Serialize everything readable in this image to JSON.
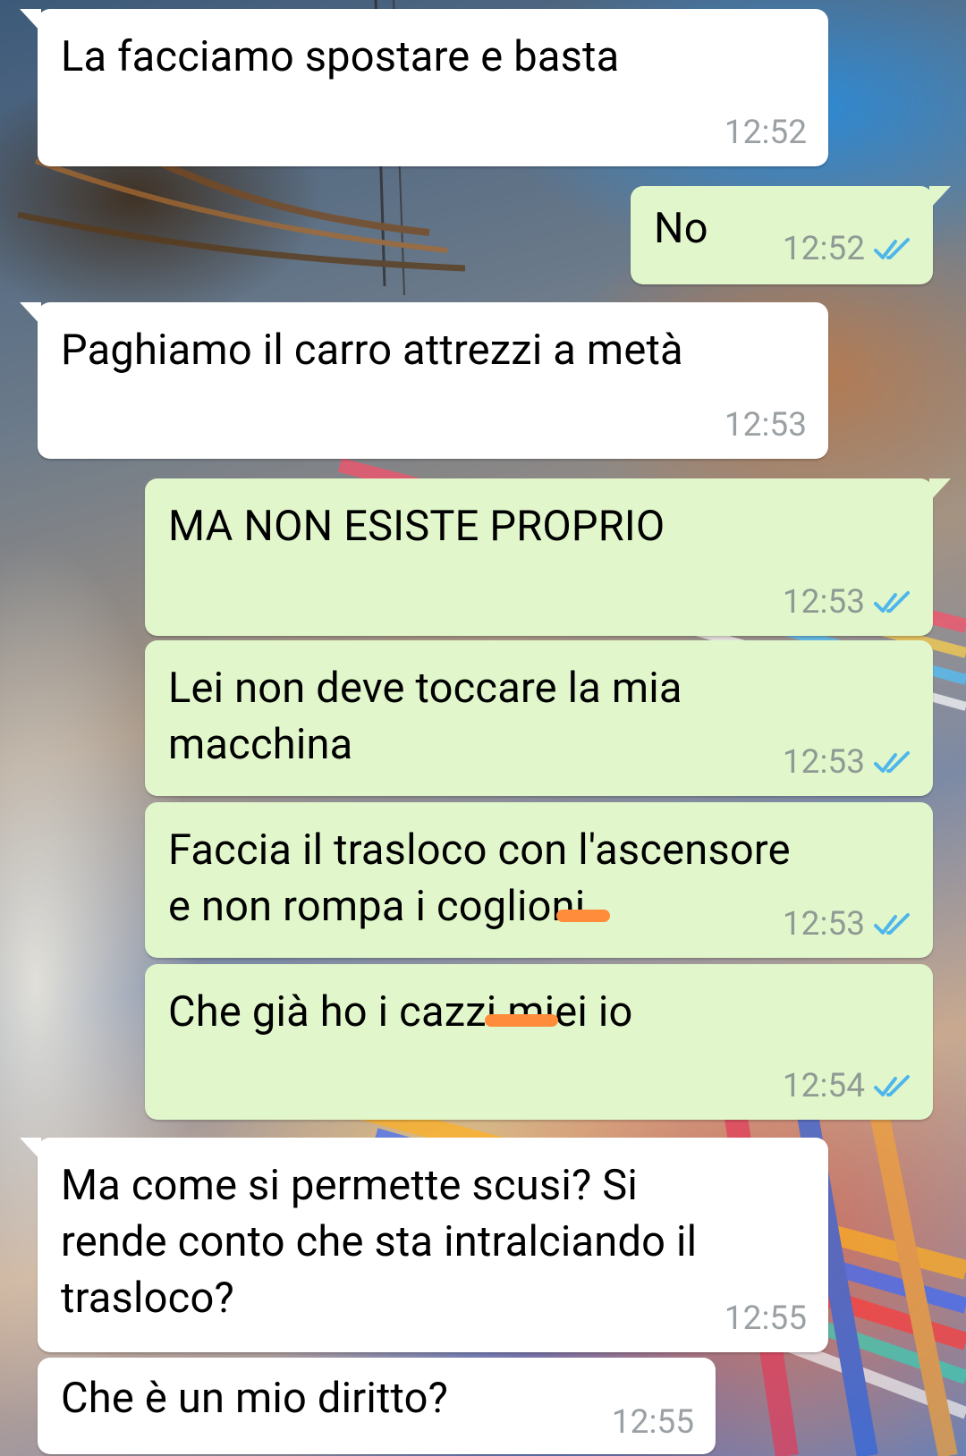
{
  "messages": [
    {
      "id": "m1",
      "direction": "incoming",
      "text": "La facciamo spostare e basta",
      "time": "12:52"
    },
    {
      "id": "m2",
      "direction": "outgoing",
      "text": "No",
      "time": "12:52",
      "status": "read"
    },
    {
      "id": "m3",
      "direction": "incoming",
      "text": "Paghiamo il carro attrezzi a metà",
      "time": "12:53"
    },
    {
      "id": "m4",
      "direction": "outgoing",
      "text": "MA NON ESISTE PROPRIO",
      "time": "12:53",
      "status": "read"
    },
    {
      "id": "m5",
      "direction": "outgoing",
      "text": "Lei non deve toccare la mia\nmacchina",
      "time": "12:53",
      "status": "read"
    },
    {
      "id": "m6",
      "direction": "outgoing",
      "text": "Faccia il trasloco con l'ascensore\ne non rompa i coglioni",
      "time": "12:53",
      "status": "read"
    },
    {
      "id": "m7",
      "direction": "outgoing",
      "text": "Che già ho i cazzi miei io",
      "time": "12:54",
      "status": "read"
    },
    {
      "id": "m8",
      "direction": "incoming",
      "text": "Ma come si permette scusi? Si\nrende conto che sta intralciando il\ntrasloco?",
      "time": "12:55"
    },
    {
      "id": "m9",
      "direction": "incoming",
      "text": "Che è un mio diritto?",
      "time": "12:55"
    }
  ],
  "colors": {
    "incoming_bubble": "#ffffff",
    "outgoing_bubble": "#e1f7cb",
    "read_tick": "#4fb6ec",
    "timestamp": "#8f9a94",
    "censor_mark": "#ff8c3a"
  },
  "icons": {
    "read_receipt": "double-check-icon"
  }
}
